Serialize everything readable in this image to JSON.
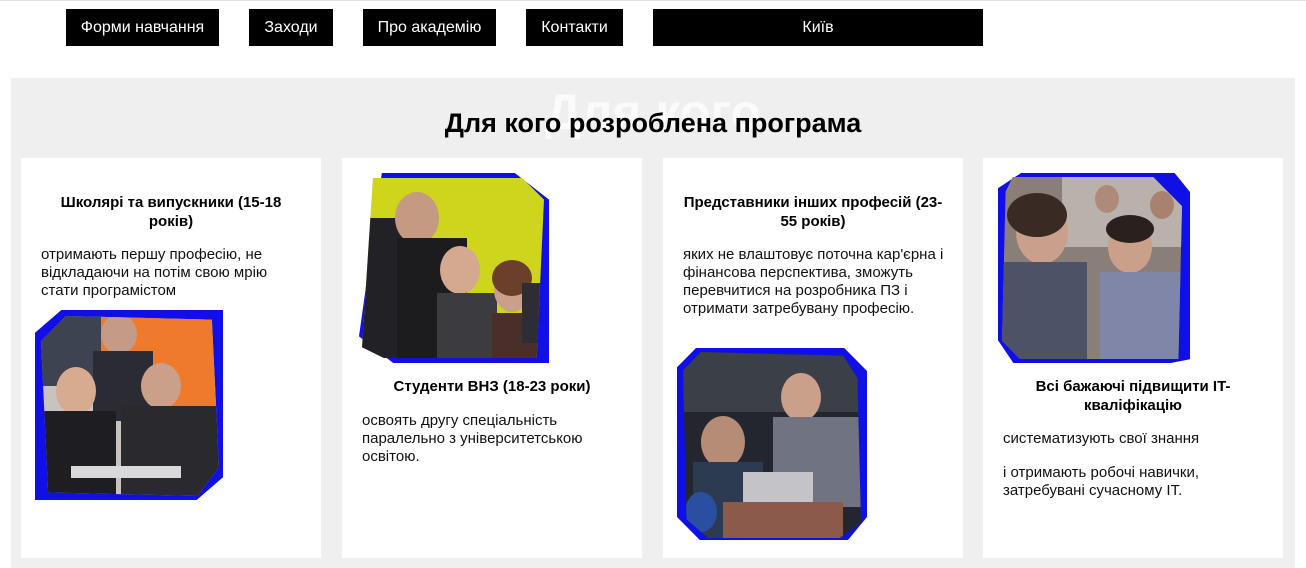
{
  "nav": {
    "items": [
      {
        "label": "Форми навчання"
      },
      {
        "label": "Заходи"
      },
      {
        "label": "Про академію"
      },
      {
        "label": "Контакти"
      }
    ],
    "city": "Київ"
  },
  "section": {
    "ghost_title": "Для кого",
    "title": "Для кого розроблена програма"
  },
  "cards": [
    {
      "title": "Школярі та випускники (15-18 років)",
      "text": "отримають першу професію, не відкладаючи на потім свою мрію стати програмістом"
    },
    {
      "title": "Студенти ВНЗ (18-23 роки)",
      "text": "освоять другу спеціальність паралельно з університетською освітою."
    },
    {
      "title": "Представники інших професій (23-55 років)",
      "text": "яких не влаштовує поточна кар'єрна і фінансова перспектива, зможуть перевчитися на розробника ПЗ і отримати затребувану професію."
    },
    {
      "title": "Всі бажаючі підвищити IT-кваліфікацію",
      "text": "систематизують свої знання",
      "text2": "і отримають робочі навички, затребувані сучасному IT."
    }
  ],
  "colors": {
    "nav_bg": "#000000",
    "nav_text": "#ffffff",
    "section_bg": "#efefef",
    "card_bg": "#ffffff",
    "photo_frame": "#1010e6"
  },
  "icons": {
    "card1_photo": "students-at-laptop-photo",
    "card2_photo": "mentor-with-students-photo",
    "card3_photo": "group-around-computer-photo",
    "card4_photo": "audience-listening-photo"
  }
}
